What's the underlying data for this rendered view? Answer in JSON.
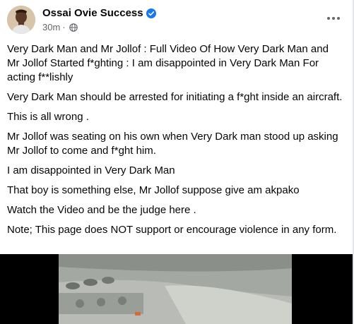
{
  "post": {
    "author": "Ossai Ovie Success",
    "timestamp": "30m",
    "separator": "·",
    "audience_icon": "globe-icon",
    "verified_icon": "verified-badge-icon",
    "more_icon": "more-options-icon",
    "paragraphs": [
      "Very Dark Man and Mr Jollof : Full Video Of How Very Dark Man and Mr Jollof Started f*ghting : I am disappointed in Very Dark Man For acting f**lishly",
      "Very Dark Man should be arrested for initiating a  f*ght inside an aircraft.",
      "This is all wrong .",
      "Mr Jollof was seating on his own when Very Dark man stood up asking Mr Jollof to come and f*ght him.",
      "I am disappointed in Very Dark Man",
      "That boy is something else, Mr Jollof suppose give am akpako",
      "Watch the Video and be the judge here .",
      "Note; This page does NOT support or encourage violence in any form."
    ]
  },
  "colors": {
    "verified_blue": "#1877f2",
    "secondary_text": "#65676b",
    "primary_text": "#050505"
  }
}
